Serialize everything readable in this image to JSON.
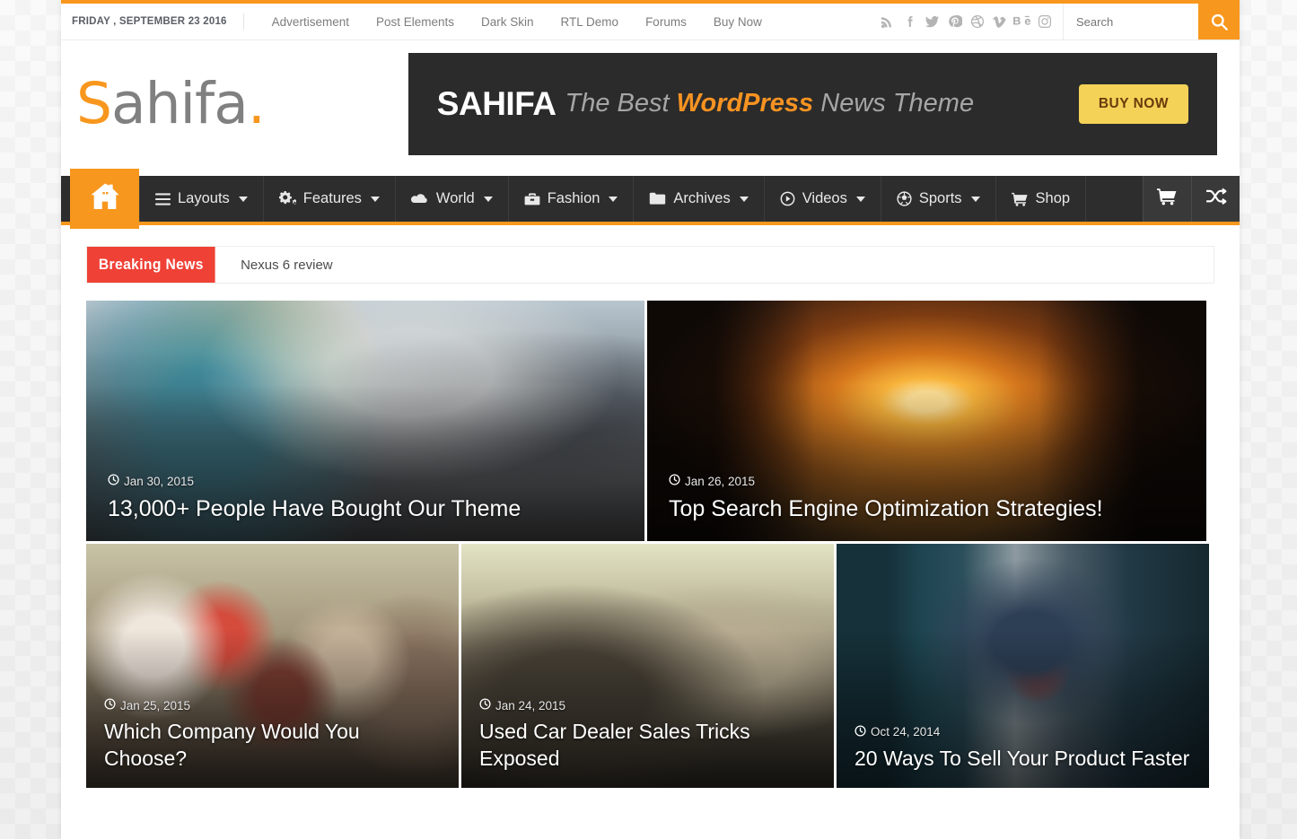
{
  "theme": {
    "accent": "#f8971d",
    "nav_bg": "#2d2d2d",
    "breaking_bg": "#ef4136",
    "page_bg": "#ffffff"
  },
  "topbar": {
    "date": "FRIDAY , SEPTEMBER 23 2016",
    "links": [
      {
        "label": "Advertisement"
      },
      {
        "label": "Post Elements"
      },
      {
        "label": "Dark Skin"
      },
      {
        "label": "RTL Demo"
      },
      {
        "label": "Forums"
      },
      {
        "label": "Buy Now"
      }
    ],
    "social": [
      {
        "name": "rss-icon",
        "title": "RSS"
      },
      {
        "name": "facebook-icon",
        "title": "Facebook"
      },
      {
        "name": "twitter-icon",
        "title": "Twitter"
      },
      {
        "name": "pinterest-icon",
        "title": "Pinterest"
      },
      {
        "name": "dribbble-icon",
        "title": "Dribbble"
      },
      {
        "name": "vimeo-icon",
        "title": "Vimeo"
      },
      {
        "name": "behance-icon",
        "title": "Behance"
      },
      {
        "name": "instagram-icon",
        "title": "Instagram"
      }
    ],
    "search": {
      "placeholder": "Search",
      "value": "",
      "button_icon": "search-icon"
    }
  },
  "header": {
    "logo": {
      "first_letter": "S",
      "middle": "ahifa",
      "dot": "."
    },
    "ad": {
      "brand": "SAHIFA",
      "tagline_pre": "The Best ",
      "tagline_accent": "WordPress",
      "tagline_post": " News Theme",
      "button": "BUY NOW"
    }
  },
  "mainnav": {
    "home_icon": "home-icon",
    "items": [
      {
        "label": "Layouts",
        "icon": "bars-icon",
        "caret": true
      },
      {
        "label": "Features",
        "icon": "gears-icon",
        "caret": true
      },
      {
        "label": "World",
        "icon": "cloud-icon",
        "caret": true
      },
      {
        "label": "Fashion",
        "icon": "briefcase-icon",
        "caret": true
      },
      {
        "label": "Archives",
        "icon": "folder-icon",
        "caret": true
      },
      {
        "label": "Videos",
        "icon": "play-circle-icon",
        "caret": true
      },
      {
        "label": "Sports",
        "icon": "soccer-ball-icon",
        "caret": true
      },
      {
        "label": "Shop",
        "icon": "cart-icon",
        "caret": false
      }
    ],
    "right_buttons": [
      {
        "name": "cart-button",
        "icon": "cart-icon"
      },
      {
        "name": "random-button",
        "icon": "shuffle-icon"
      }
    ]
  },
  "breaking": {
    "label": "Breaking News",
    "headline": "Nexus 6 review"
  },
  "featured": {
    "row1": [
      {
        "title": "13,000+ People Have Bought Our Theme",
        "date": "Jan 30, 2015",
        "photo": "ph-theme"
      },
      {
        "title": "Top Search Engine Optimization Strategies!",
        "date": "Jan 26, 2015",
        "photo": "ph-seo"
      }
    ],
    "row2": [
      {
        "title": "Which Company Would You Choose?",
        "date": "Jan 25, 2015",
        "photo": "ph-locks"
      },
      {
        "title": "Used Car Dealer Sales Tricks Exposed",
        "date": "Jan 24, 2015",
        "photo": "ph-car"
      },
      {
        "title": "20 Ways To Sell Your Product Faster",
        "date": "Oct 24, 2014",
        "photo": "ph-server"
      }
    ]
  }
}
